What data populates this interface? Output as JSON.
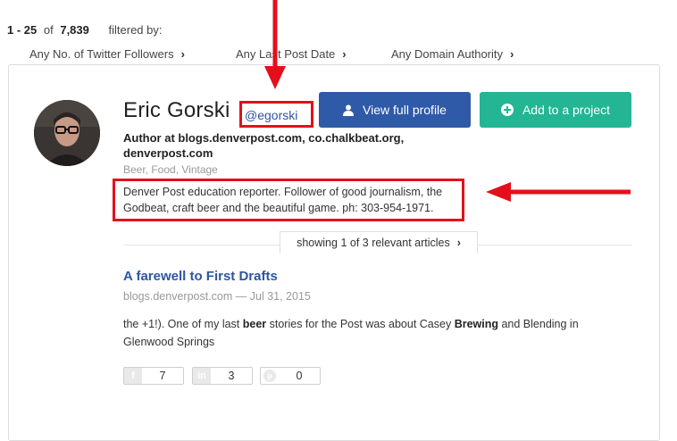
{
  "results": {
    "range": "1 - 25",
    "of_label": "of",
    "total": "7,839",
    "filtered_by": "filtered by:"
  },
  "filters": [
    {
      "label": "Any No. of Twitter Followers"
    },
    {
      "label": "Any Last Post Date"
    },
    {
      "label": "Any Domain Authority"
    }
  ],
  "profile": {
    "name": "Eric Gorski",
    "handle": "@egorski",
    "title_line_1": "Author at blogs.denverpost.com, co.chalkbeat.org,",
    "title_line_2": "denverpost.com",
    "tags": "Beer, Food, Vintage",
    "bio": "Denver Post education reporter. Follower of good journalism, the Godbeat, craft beer and the beautiful game. ph: 303-954-1971.",
    "avatar": "avatar-photo"
  },
  "buttons": {
    "view_profile": "View full profile",
    "add_project": "Add to a project"
  },
  "articles_tab": {
    "pre": "showing ",
    "count": "1 of 3",
    "post": " relevant articles"
  },
  "article": {
    "title": "A farewell to First Drafts",
    "meta": "blogs.denverpost.com — Jul 31, 2015",
    "snippet": {
      "t1": "the +1!). One of my last ",
      "b1": "beer",
      "t2": " stories for the Post was about Casey ",
      "b2": "Brewing",
      "t3": " and Blending in Glenwood Springs"
    }
  },
  "shares": [
    {
      "icon": "facebook-icon",
      "glyph": "f",
      "count": "7"
    },
    {
      "icon": "linkedin-icon",
      "glyph": "in",
      "count": "3"
    },
    {
      "icon": "pinterest-icon",
      "glyph": "p",
      "count": "0"
    }
  ],
  "colors": {
    "annotation_red": "#e3101b",
    "link_blue": "#2d55a4",
    "button_blue": "#2f5aa8",
    "button_green": "#23b594"
  }
}
